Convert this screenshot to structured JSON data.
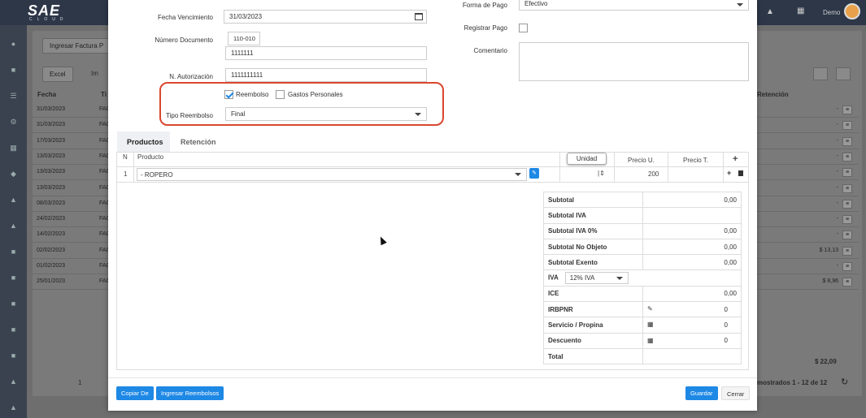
{
  "app": {
    "logo": "SAE",
    "logo_sub": "CLOUD",
    "user": "Demo"
  },
  "background": {
    "ingresar_factura": "Ingresar Factura P",
    "excel": "Excel",
    "imprimir": "Im",
    "col_fecha": "Fecha",
    "col_t": "Ti",
    "col_retencion": "Retención",
    "rows": [
      {
        "fecha": "31/03/2023",
        "t": "FAC"
      },
      {
        "fecha": "31/03/2023",
        "t": "FAC"
      },
      {
        "fecha": "17/03/2023",
        "t": "FAC"
      },
      {
        "fecha": "13/03/2023",
        "t": "FAC"
      },
      {
        "fecha": "13/03/2023",
        "t": "FAC"
      },
      {
        "fecha": "13/03/2023",
        "t": "FAC"
      },
      {
        "fecha": "08/03/2023",
        "t": "FAC"
      },
      {
        "fecha": "24/02/2023",
        "t": "FAC"
      },
      {
        "fecha": "14/02/2023",
        "t": "FAC"
      },
      {
        "fecha": "02/02/2023",
        "t": "FAC"
      },
      {
        "fecha": "01/02/2023",
        "t": "FAC"
      },
      {
        "fecha": "25/01/2023",
        "t": "FAC"
      }
    ],
    "right_values": [
      "-",
      "-",
      "-",
      "-",
      "-",
      "-",
      "-",
      "-",
      "-",
      "$ 13,13",
      "-",
      "$ 8,96"
    ],
    "total": "$ 22,09",
    "pagination": "mostrados 1 - 12 de 12",
    "page": "1"
  },
  "form": {
    "fecha_vencimiento_label": "Fecha Vencimiento",
    "fecha_vencimiento": "31/03/2023",
    "numero_documento_label": "Número Documento",
    "numero_documento_prefix": "110-010",
    "numero_documento": "1111111",
    "autorizacion_label": "N. Autorización",
    "autorizacion": "1111111111",
    "reembolso_label": "Reembolso",
    "gastos_label": "Gastos Personales",
    "tipo_reembolso_label": "Tipo Reembolso",
    "tipo_reembolso": "Final",
    "forma_pago_label": "Forma de Pago",
    "forma_pago": "Efectivo",
    "registrar_pago_label": "Registrar Pago",
    "comentario_label": "Comentario"
  },
  "tabs": {
    "productos": "Productos",
    "retencion": "Retención"
  },
  "products": {
    "col_n": "N",
    "col_producto": "Producto",
    "col_unidad": "Unidad",
    "col_precio_u": "Precio U.",
    "col_precio_t": "Precio T.",
    "add": "+",
    "row": {
      "n": "1",
      "producto": "- ROPERO",
      "precio_u": "200"
    }
  },
  "totals": [
    {
      "label": "Subtotal",
      "value": "0,00"
    },
    {
      "label": "Subtotal IVA",
      "value": ""
    },
    {
      "label": "Subtotal IVA 0%",
      "value": "0,00"
    },
    {
      "label": "Subtotal No Objeto",
      "value": "0,00"
    },
    {
      "label": "Subtotal Exento",
      "value": "0,00"
    },
    {
      "label": "IVA",
      "value": "",
      "select": "12% IVA"
    },
    {
      "label": "ICE",
      "value": "0,00"
    },
    {
      "label": "IRBPNR",
      "value": "0"
    },
    {
      "label": "Servicio / Propina",
      "value": "0"
    },
    {
      "label": "Descuento",
      "value": "0"
    },
    {
      "label": "Total",
      "value": ""
    }
  ],
  "buttons": {
    "copiar": "Copiar De",
    "ingresar_reembolsos": "Ingresar Reembolsos",
    "guardar": "Guardar",
    "cerrar": "Cerrar"
  }
}
